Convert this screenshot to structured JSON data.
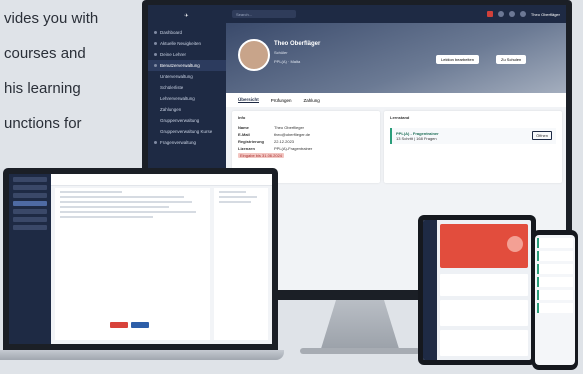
{
  "intro": {
    "lines": [
      "vides you with",
      "courses and",
      "his learning",
      "unctions for"
    ]
  },
  "desktop": {
    "search_placeholder": "Search...",
    "user": {
      "name": "Theo Oberfläger",
      "role": "Schüler",
      "tags": "PPL(A)",
      "secondary": "Malta"
    },
    "hero_buttons": [
      "Lektion bearbeiten",
      "Zu Schulen"
    ],
    "tabs": [
      "Übersicht",
      "Prüfungen",
      "Zahlung"
    ],
    "info_card": {
      "title": "Info",
      "rows": [
        {
          "k": "Name",
          "v": "Theo Oberflieger"
        },
        {
          "k": "E-Mail",
          "v": "theo@oberflieger.de"
        },
        {
          "k": "Registrierung",
          "v": "22.12.2023"
        },
        {
          "k": "Lizenzen",
          "v": "PPL(A)-Fragentrainer"
        }
      ],
      "badge": "Eingabe bis 31.06.2024"
    },
    "courses_card": {
      "title": "Lernstand",
      "course_name": "PPL(A) - Fragentrainer",
      "course_sub": "13 Schritt | 168 Fragen",
      "course_button": "Öffnen"
    },
    "sidebar": [
      "Dashboard",
      "Aktuelle Neuigkeiten",
      "Deine Lehrer",
      "Benutzerverwaltung",
      "Unterverwaltung",
      "Schülerliste",
      "Lehrerverwaltung",
      "Zahlungen",
      "Gruppenverwaltung",
      "Gruppenverwaltung Kurse",
      "Fragenverwaltung"
    ]
  },
  "colors": {
    "navy": "#1e2a44",
    "accent_red": "#e24d3d",
    "accent_green": "#2a9d7a"
  }
}
